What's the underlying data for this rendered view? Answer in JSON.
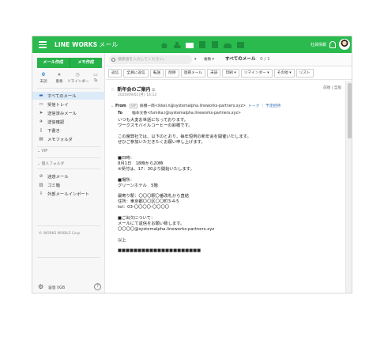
{
  "app": {
    "logo": "LINE WORKS",
    "service": "メール"
  },
  "user": {
    "name": "社員情報"
  },
  "colors": {
    "brand": "#2aba4e",
    "selected": "#dcebf7",
    "link": "#2b6fb5"
  },
  "app_icons": [
    "home-icon",
    "contacts-icon",
    "mail-icon",
    "calendar-icon",
    "board-icon",
    "drive-icon",
    "task-icon"
  ],
  "sidebar": {
    "buttons": {
      "new_mail": "メール作成",
      "memo": "メモ作成"
    },
    "shortcuts": [
      {
        "value": "0",
        "label": "未読"
      },
      {
        "value": "★",
        "label": "重要"
      },
      {
        "value": "◷",
        "label": "リマインダー"
      },
      {
        "value": "▭",
        "label": "To"
      }
    ],
    "folders": [
      {
        "icon": "inbox-icon",
        "label": "すべてのメール"
      },
      {
        "icon": "inbox-tray-icon",
        "label": "受信トレイ"
      },
      {
        "icon": "sent-icon",
        "label": "送信済みメール"
      },
      {
        "icon": "confirm-icon",
        "label": "送信確認"
      },
      {
        "icon": "draft-icon",
        "label": "下書き"
      },
      {
        "icon": "memo-folder-icon",
        "label": "メモフォルダ"
      }
    ],
    "vip_label": "VIP",
    "personal_label": "個人フォルダ",
    "other_folders": [
      {
        "icon": "block-icon",
        "label": "迷惑メール"
      },
      {
        "icon": "trash-icon",
        "label": "ゴミ箱"
      },
      {
        "icon": "import-icon",
        "label": "外部メールインポート"
      }
    ],
    "copyright": "© WORKS MOBILE Corp.",
    "storage": "容量 0GB"
  },
  "search": {
    "placeholder": "検索語を入力してください。",
    "option": "▾",
    "sort": "複数 ▾"
  },
  "mailbox": {
    "title": "すべてのメール",
    "count": "0 / 1"
  },
  "toolbar": [
    "返信",
    "全員に返信",
    "転送",
    "削除",
    "迷惑メール",
    "未読",
    "印刷 ▾",
    "リマインダー ▾",
    "その他 ▾",
    "リスト"
  ],
  "message": {
    "subject": "新年会のご案内",
    "date": "2020/09/01(月) 14:12",
    "view_links": "前後 | 全般",
    "from_key": "From",
    "from_tag": "VIP",
    "from": "斜橋一郎<ikkei.n@systemalpha.lineworks-partners.xyz>",
    "from_links": {
      "talk": "トーク",
      "schedule": "予定招待"
    },
    "to_key": "To",
    "to": "稲本文香<fumika.i@systemalpha.lineworks-partners.xyz>",
    "body": [
      "いつも大変お世話になっております。",
      "ワークスモバイルコーヒーの斜橋です。",
      "",
      "この度弊社では、以下のとおり、毎年恒例の新年会を開催いたします。",
      "ぜひご参加いただきたくお願い申し上げます。",
      "",
      "",
      "■日時：",
      "8月1日　18時から20時",
      "※受付は、17：30より開始いたします。",
      "",
      "■場所：",
      "グリーンホテル　5階",
      "",
      "最寄り駅：〇〇〇駅〇番改札から直結",
      "住所：東京都〇〇区〇〇町3-4-5",
      "tel：03-〇〇〇〇-〇〇〇〇",
      "",
      "■ご出欠について：",
      "メールにて返信をお願い致します。",
      "〇〇〇〇@systemalpha.lineworks-partners.xyz",
      "",
      "以上",
      "",
      "■■■■■■■■■■■■■■■■■■■■■"
    ]
  }
}
